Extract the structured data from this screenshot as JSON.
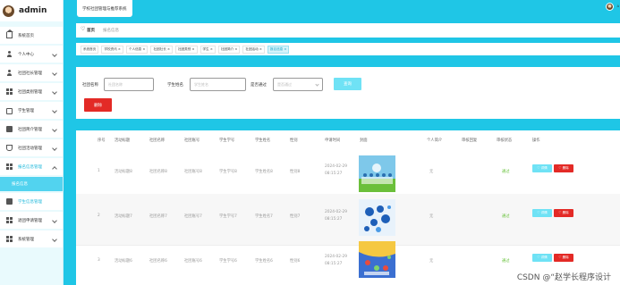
{
  "app": {
    "brand_title": "admin",
    "system_title": "学校社团管理与推荐系统",
    "user_label": "A"
  },
  "sidebar": {
    "items": [
      {
        "label": "系统首页",
        "icon": "home-icon"
      },
      {
        "label": "个人中心",
        "icon": "user-icon"
      },
      {
        "label": "社团社长管理",
        "icon": "user-icon"
      },
      {
        "label": "社团类别管理",
        "icon": "grid-icon"
      },
      {
        "label": "学生管理",
        "icon": "briefcase-icon"
      },
      {
        "label": "社团简介管理",
        "icon": "chat-icon"
      },
      {
        "label": "社团活动管理",
        "icon": "trophy-icon"
      },
      {
        "label": "报名信息管理",
        "icon": "grid-icon"
      },
      {
        "label": "报名信息",
        "icon": ""
      },
      {
        "label": "学生信息管理",
        "icon": "chat-icon"
      },
      {
        "label": "退团申请管理",
        "icon": "grid-icon"
      },
      {
        "label": "系统管理",
        "icon": "grid-icon"
      }
    ]
  },
  "breadcrumb": {
    "home": "首页",
    "current": "报名信息"
  },
  "tabs": [
    "系统首页 ",
    "学校资讯 ×",
    "个人信息 ×",
    "社团社长 ×",
    "社团类别 ×",
    "学生 ×",
    "社团简介 ×",
    "社团活动 ×",
    "报名信息 ×"
  ],
  "search": {
    "club_name_label": "社团名称",
    "club_name_placeholder": "社团名称",
    "student_name_label": "学生姓名",
    "student_name_placeholder": "学生姓名",
    "approved_label": "是否通过",
    "approved_placeholder": "是否通过",
    "search_button": "查询",
    "delete_button": "删除"
  },
  "table": {
    "headers": [
      "序号",
      "活动标题",
      "社团名称",
      "社团账号",
      "学生学号",
      "学生姓名",
      "性别",
      "申请时间",
      "封面",
      "个人简介",
      "审核回复",
      "审核状态",
      "操作"
    ],
    "rows": [
      {
        "no": "1",
        "title": "活动标题8",
        "club": "社团名称8",
        "account": "社团账号8",
        "student_no": "学生学号8",
        "student_name": "学生姓名8",
        "gender": "性别8",
        "date": "2024-02-29",
        "time": "08:15:27",
        "intro": "无",
        "reply": "",
        "status": "通过"
      },
      {
        "no": "2",
        "title": "活动标题7",
        "club": "社团名称7",
        "account": "社团账号7",
        "student_no": "学生学号7",
        "student_name": "学生姓名7",
        "gender": "性别7",
        "date": "2024-02-29",
        "time": "08:15:27",
        "intro": "无",
        "reply": "",
        "status": "通过"
      },
      {
        "no": "3",
        "title": "活动标题6",
        "club": "社团名称6",
        "account": "社团账号6",
        "student_no": "学生学号6",
        "student_name": "学生姓名6",
        "gender": "性别6",
        "date": "2024-02-29",
        "time": "08:15:27",
        "intro": "无",
        "reply": "",
        "status": "通过"
      }
    ],
    "view_button": "♡ 详情",
    "delete_button": "♡ 删除"
  },
  "watermark": "CSDN @“赵学长程序设计"
}
